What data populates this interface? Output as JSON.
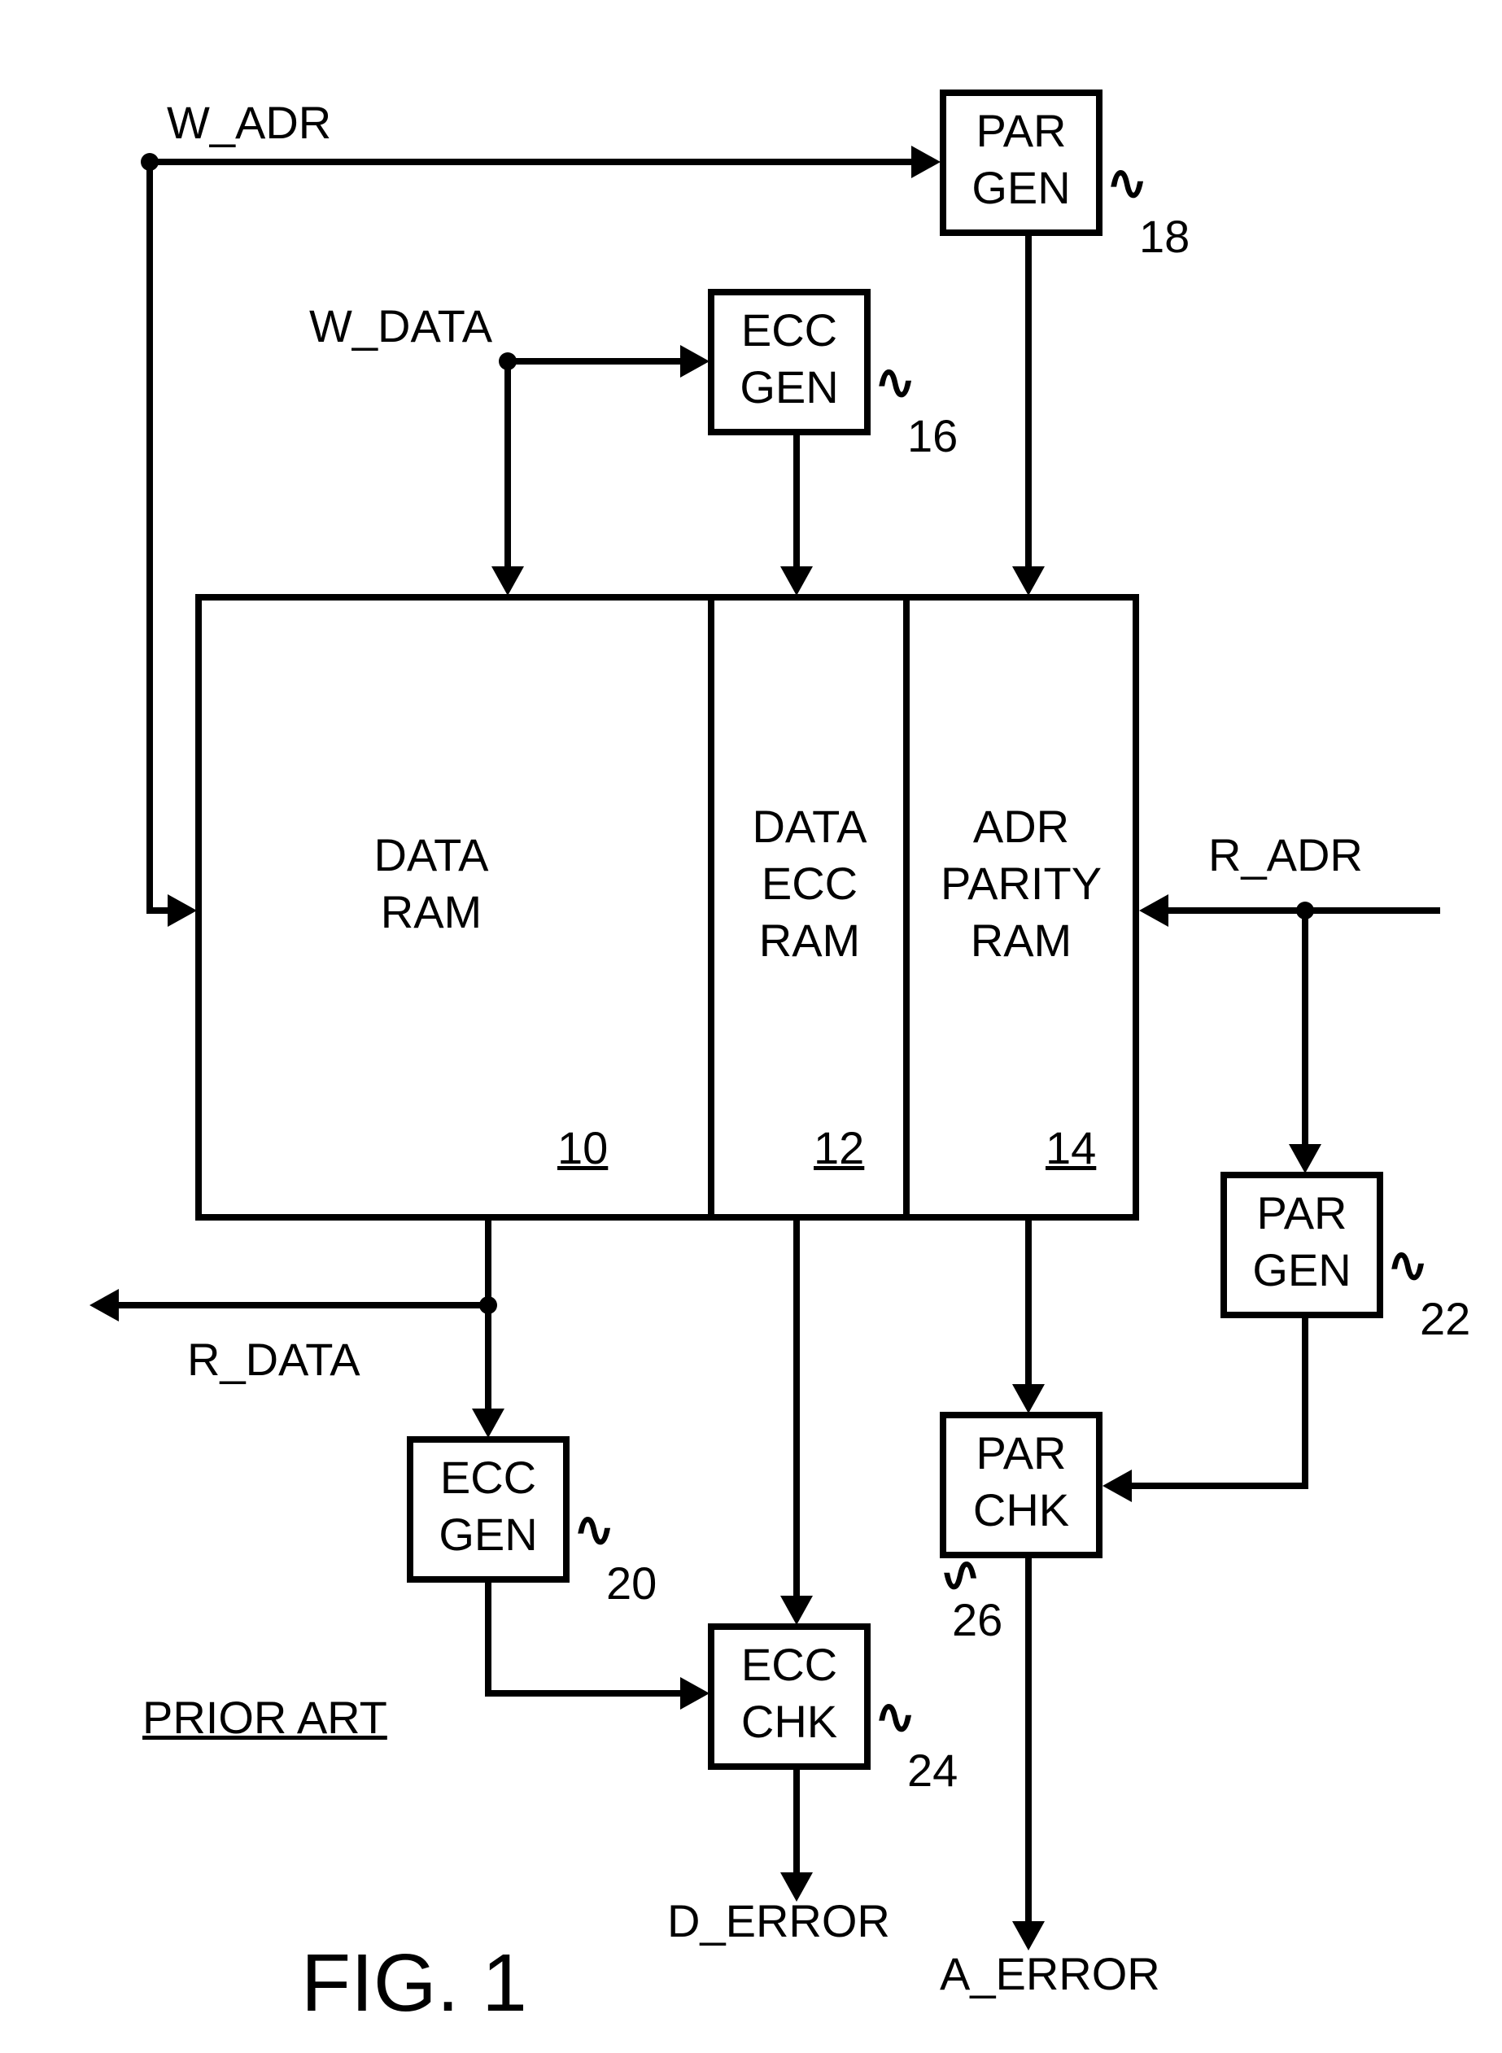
{
  "signals": {
    "w_adr": "W_ADR",
    "w_data": "W_DATA",
    "r_adr": "R_ADR",
    "r_data": "R_DATA",
    "d_error": "D_ERROR",
    "a_error": "A_ERROR"
  },
  "blocks": {
    "par_gen_top": {
      "line1": "PAR",
      "line2": "GEN",
      "ref": "18"
    },
    "ecc_gen_top": {
      "line1": "ECC",
      "line2": "GEN",
      "ref": "16"
    },
    "data_ram": {
      "line1": "DATA",
      "line2": "RAM",
      "ref": "10"
    },
    "data_ecc_ram": {
      "line1": "DATA",
      "line2": "ECC",
      "line3": "RAM",
      "ref": "12"
    },
    "adr_par_ram": {
      "line1": "ADR",
      "line2": "PARITY",
      "line3": "RAM",
      "ref": "14"
    },
    "par_gen_r": {
      "line1": "PAR",
      "line2": "GEN",
      "ref": "22"
    },
    "ecc_gen_b": {
      "line1": "ECC",
      "line2": "GEN",
      "ref": "20"
    },
    "par_chk": {
      "line1": "PAR",
      "line2": "CHK",
      "ref": "26"
    },
    "ecc_chk": {
      "line1": "ECC",
      "line2": "CHK",
      "ref": "24"
    }
  },
  "misc": {
    "prior_art": "PRIOR ART",
    "figure": "FIG. 1"
  }
}
